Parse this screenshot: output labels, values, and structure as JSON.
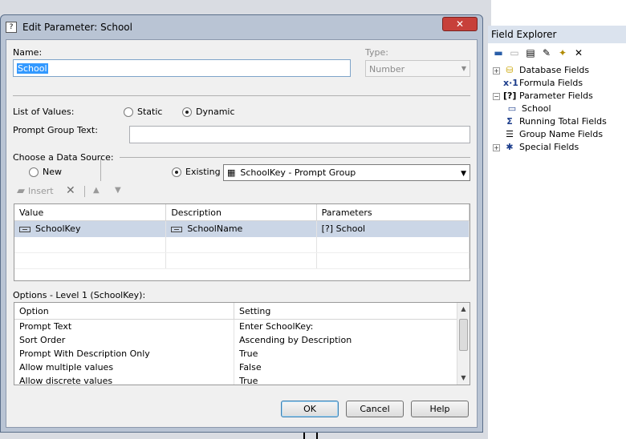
{
  "field_explorer": {
    "title": "Field Explorer",
    "toolbar_icons": [
      "insert-icon",
      "browse-icon",
      "new-icon",
      "edit-icon",
      "rename-icon",
      "delete-icon"
    ],
    "items": [
      {
        "label": "Database Fields",
        "icon": "database-icon",
        "expand": "+"
      },
      {
        "label": "Formula Fields",
        "icon": "formula-icon",
        "expand": ""
      },
      {
        "label": "Parameter Fields",
        "icon": "parameter-icon",
        "expand": "−"
      },
      {
        "label": "School",
        "icon": "field-icon",
        "expand": ""
      },
      {
        "label": "Running Total Fields",
        "icon": "sum-icon",
        "expand": ""
      },
      {
        "label": "Group Name Fields",
        "icon": "group-icon",
        "expand": ""
      },
      {
        "label": "Special Fields",
        "icon": "special-icon",
        "expand": "+"
      }
    ]
  },
  "dialog": {
    "title": "Edit Parameter: School",
    "close_label": "✕",
    "name_label": "Name:",
    "name_value": "School",
    "type_label": "Type:",
    "type_value": "Number",
    "list_of_values_label": "List of Values:",
    "static_label": "Static",
    "dynamic_label": "Dynamic",
    "prompt_group_label": "Prompt Group Text:",
    "prompt_group_value": "",
    "data_source_label": "Choose a Data Source:",
    "new_label": "New",
    "existing_label": "Existing",
    "existing_value": "SchoolKey - Prompt Group",
    "toolbar": {
      "insert_label": "Insert"
    },
    "grid": {
      "headers": [
        "Value",
        "Description",
        "Parameters"
      ],
      "rows": [
        {
          "value": "SchoolKey",
          "description": "SchoolName",
          "parameters": "[?] School"
        }
      ]
    },
    "options_label": "Options - Level 1 (SchoolKey):",
    "options": {
      "headers": [
        "Option",
        "Setting"
      ],
      "rows": [
        {
          "option": "Prompt Text",
          "setting": "Enter SchoolKey:"
        },
        {
          "option": "Sort Order",
          "setting": "Ascending by Description"
        },
        {
          "option": "Prompt With Description Only",
          "setting": "True"
        },
        {
          "option": "Allow multiple values",
          "setting": "False"
        },
        {
          "option": "Allow discrete values",
          "setting": "True"
        }
      ]
    },
    "buttons": {
      "ok": "OK",
      "cancel": "Cancel",
      "help": "Help"
    }
  }
}
